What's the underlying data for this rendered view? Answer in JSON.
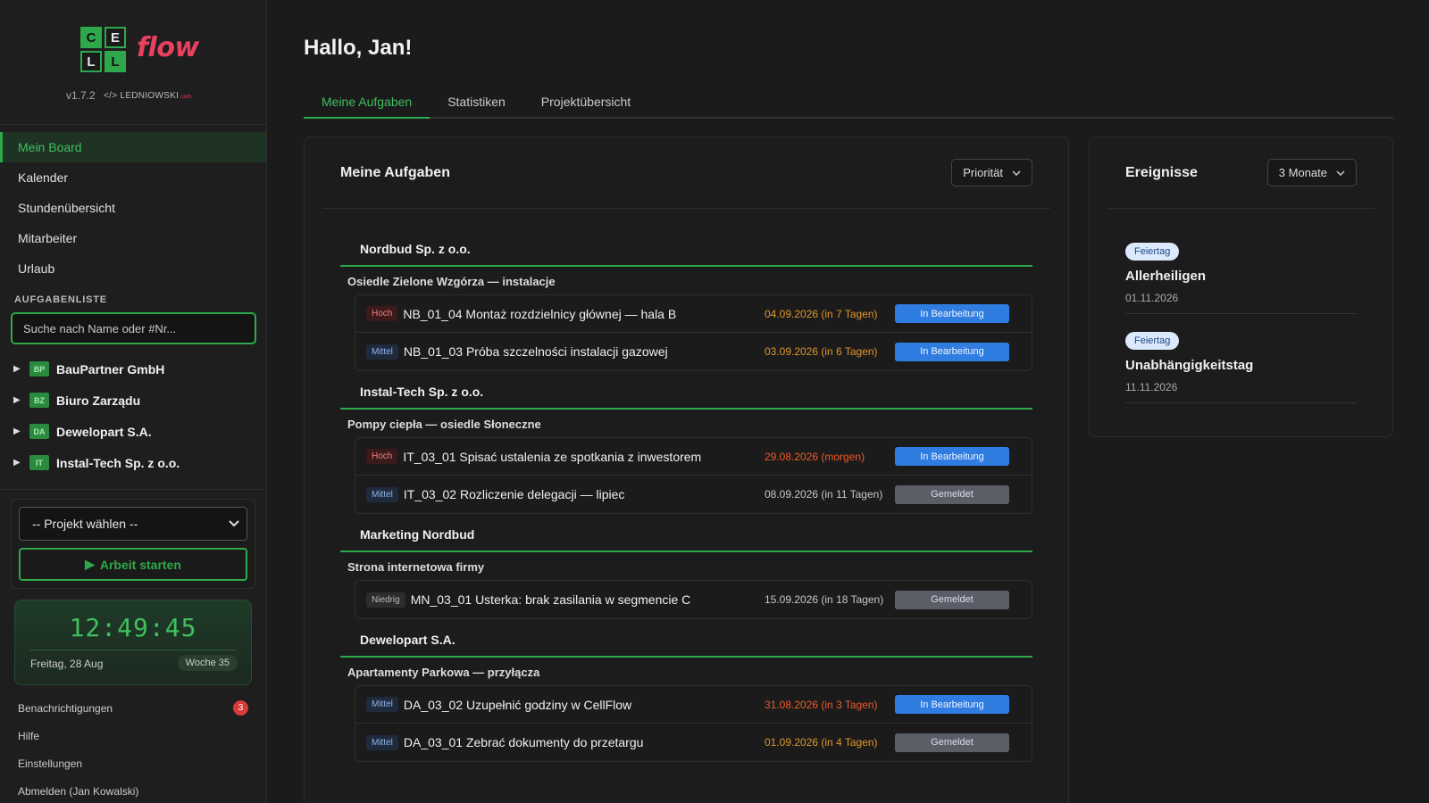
{
  "app": {
    "logo_letters": [
      "C",
      "E",
      "L",
      "L"
    ],
    "logo_word": "flow",
    "version": "v1.7.2",
    "maker": "LEDNIOWSKI",
    "maker_prefix": "</>",
    "maker_tld": ".com"
  },
  "sidebar": {
    "nav": [
      {
        "label": "Mein Board",
        "active": true
      },
      {
        "label": "Kalender"
      },
      {
        "label": "Stundenübersicht"
      },
      {
        "label": "Mitarbeiter"
      },
      {
        "label": "Urlaub"
      }
    ],
    "section_label": "AUFGABENLISTE",
    "search_placeholder": "Suche nach Name oder #Nr...",
    "tree": [
      {
        "badge": "BP",
        "label": "BauPartner GmbH"
      },
      {
        "badge": "BZ",
        "label": "Biuro Zarządu"
      },
      {
        "badge": "DA",
        "label": "Dewelopart S.A."
      },
      {
        "badge": "IT",
        "label": "Instal-Tech Sp. z o.o."
      }
    ],
    "project_select": "-- Projekt wählen --",
    "start_button": "Arbeit starten",
    "clock": {
      "time": "12:49:45",
      "date": "Freitag, 28 Aug",
      "week": "Woche 35"
    },
    "bottom_links": [
      {
        "label": "Benachrichtigungen",
        "badge": "3"
      },
      {
        "label": "Hilfe"
      },
      {
        "label": "Einstellungen"
      },
      {
        "label": "Abmelden (Jan Kowalski)"
      }
    ]
  },
  "main": {
    "greeting": "Hallo, Jan!",
    "tabs": [
      {
        "label": "Meine Aufgaben",
        "active": true
      },
      {
        "label": "Statistiken"
      },
      {
        "label": "Projektübersicht"
      }
    ]
  },
  "tasks_card": {
    "title": "Meine Aufgaben",
    "sort": "Priorität",
    "groups": [
      {
        "company": "Nordbud Sp. z o.o.",
        "project": "Osiedle Zielone Wzgórza — instalacje",
        "tasks": [
          {
            "prio": "Hoch",
            "name": "NB_01_04 Montaż rozdzielnicy głównej — hala B",
            "date": "04.09.2026 (in 7 Tagen)",
            "date_color": "#e0952a",
            "status": "In Bearbeitung"
          },
          {
            "prio": "Mittel",
            "name": "NB_01_03 Próba szczelności instalacji gazowej",
            "date": "03.09.2026 (in 6 Tagen)",
            "date_color": "#e0952a",
            "status": "In Bearbeitung"
          }
        ]
      },
      {
        "company": "Instal-Tech Sp. z o.o.",
        "project": "Pompy ciepła — osiedle Słoneczne",
        "tasks": [
          {
            "prio": "Hoch",
            "name": "IT_03_01 Spisać ustalenia ze spotkania z inwestorem",
            "date": "29.08.2026 (morgen)",
            "date_color": "#ef5a2a",
            "status": "In Bearbeitung"
          },
          {
            "prio": "Mittel",
            "name": "IT_03_02 Rozliczenie delegacji — lipiec",
            "date": "08.09.2026 (in 11 Tagen)",
            "date_color": "#c8c8c8",
            "status": "Gemeldet"
          }
        ]
      },
      {
        "company": "Marketing Nordbud",
        "project": "Strona internetowa firmy",
        "tasks": [
          {
            "prio": "Niedrig",
            "name": "MN_03_01 Usterka: brak zasilania w segmencie C",
            "date": "15.09.2026 (in 18 Tagen)",
            "date_color": "#c8c8c8",
            "status": "Gemeldet"
          }
        ]
      },
      {
        "company": "Dewelopart S.A.",
        "project": "Apartamenty Parkowa — przyłącza",
        "tasks": [
          {
            "prio": "Mittel",
            "name": "DA_03_02 Uzupełnić godziny w CellFlow",
            "date": "31.08.2026 (in 3 Tagen)",
            "date_color": "#ef5a2a",
            "status": "In Bearbeitung"
          },
          {
            "prio": "Mittel",
            "name": "DA_03_01 Zebrać dokumenty do przetargu",
            "date": "01.09.2026 (in 4 Tagen)",
            "date_color": "#e0952a",
            "status": "Gemeldet"
          }
        ]
      }
    ]
  },
  "events_card": {
    "title": "Ereignisse",
    "range": "3 Monate",
    "events": [
      {
        "badge": "Feiertag",
        "name": "Allerheiligen",
        "date": "01.11.2026"
      },
      {
        "badge": "Feiertag",
        "name": "Unabhängigkeitstag",
        "date": "11.11.2026"
      }
    ]
  },
  "colors": {
    "accent": "#2ea84a",
    "brand_flow": "#e8405e",
    "status_in_progress": "#2f7de0",
    "status_reported": "#5a5e66",
    "danger": "#d93b3b"
  }
}
